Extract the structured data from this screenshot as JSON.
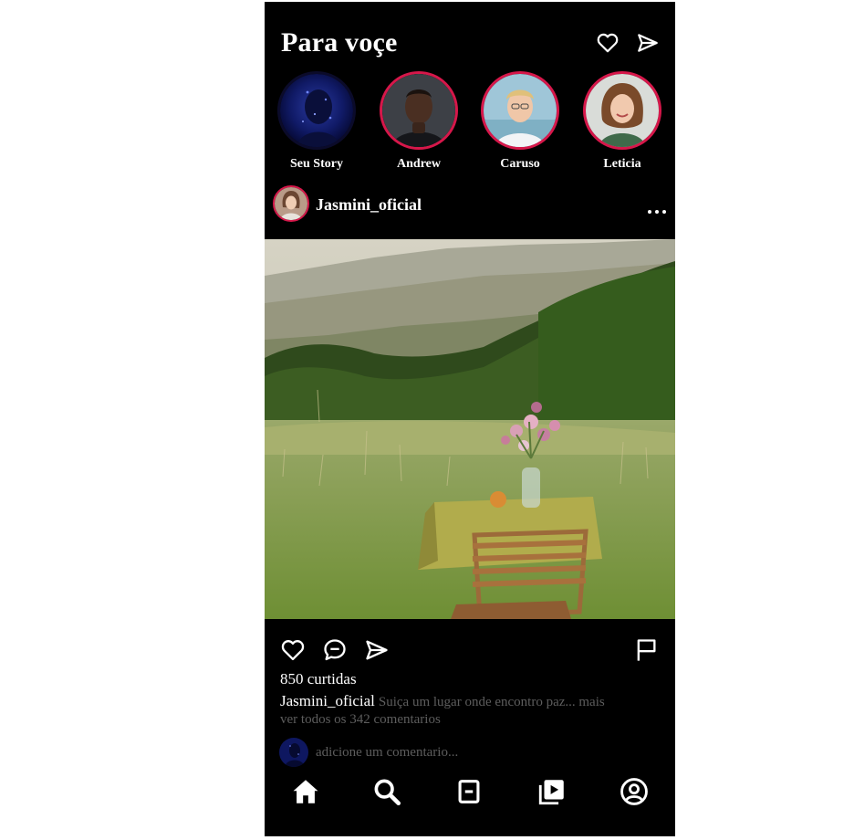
{
  "header": {
    "title": "Para voçe",
    "icons": [
      "heart-icon",
      "send-icon"
    ]
  },
  "stories": [
    {
      "name": "Seu Story",
      "own": true
    },
    {
      "name": "Andrew",
      "own": false
    },
    {
      "name": "Caruso",
      "own": false
    },
    {
      "name": "Leticia",
      "own": false
    }
  ],
  "post": {
    "username": "Jasmini_oficial",
    "image_alt": "Mesa com flores em um campo nas montanhas",
    "likes": "850 curtidas",
    "caption_user": "Jasmini_oficial",
    "caption_text": "Suiça um lugar onde encontro paz... mais",
    "view_comments": "ver todos os 342 comentarios",
    "comment_placeholder": "adicione um comentario..."
  },
  "actions": [
    "heart-icon",
    "comment-icon",
    "send-icon",
    "flag-icon"
  ],
  "bottom_nav": [
    "home-icon",
    "search-icon",
    "add-post-icon",
    "reels-icon",
    "profile-icon"
  ],
  "colors": {
    "background": "#000000",
    "story_ring": "#d6174a",
    "muted_text": "#5d5d5d",
    "text": "#ffffff"
  }
}
